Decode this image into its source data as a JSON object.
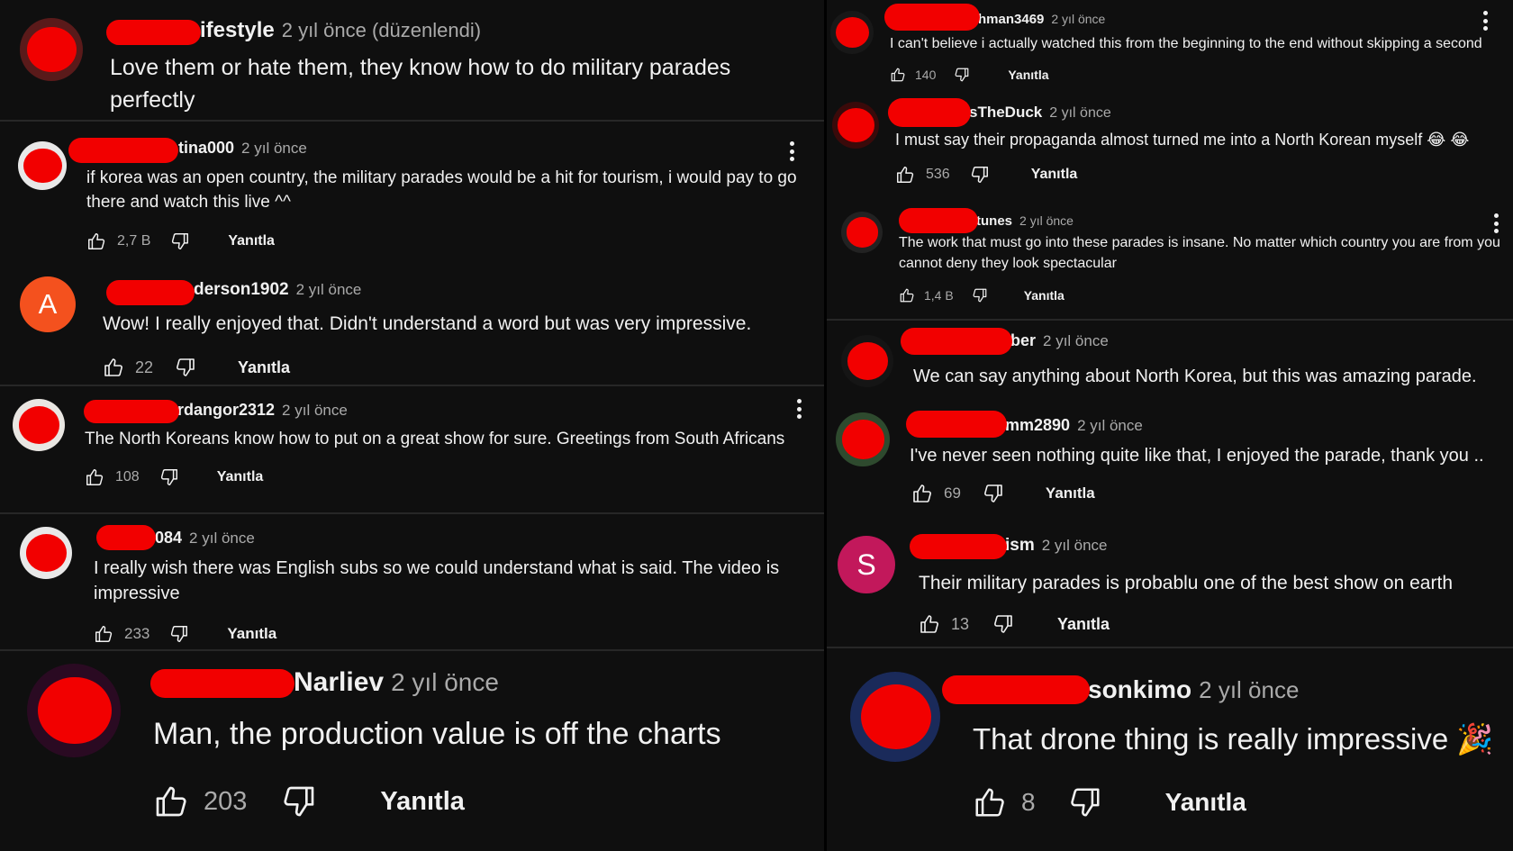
{
  "left_column": {
    "comments": [
      {
        "name": "ifestyle",
        "time": "2 yıl önce (düzenlendi)",
        "text": "Love them or hate them, they know how to do military parades perfectly"
      },
      {
        "name": "tina000",
        "time": "2 yıl önce",
        "text": "if korea was an open country, the military parades would be a hit for tourism, i would pay to go there and watch this live ^^",
        "likes": "2,7 B",
        "reply": "Yanıtla"
      },
      {
        "name": "derson1902",
        "time": "2 yıl önce",
        "avatar_initial": "A",
        "avatar_color": "#f4511e",
        "text": "Wow!  I really enjoyed that.  Didn't understand a word but was very impressive.",
        "likes": "22",
        "reply": "Yanıtla"
      },
      {
        "name": "rdangor2312",
        "time": "2 yıl önce",
        "text": "The North Koreans know how to put on a great show for sure. Greetings from South Africans",
        "likes": "108",
        "reply": "Yanıtla"
      },
      {
        "name": "084",
        "time": "2 yıl önce",
        "text": "I really wish there was English subs so we could understand what is said. The video is impressive",
        "likes": "233",
        "reply": "Yanıtla"
      },
      {
        "name": "Narliev",
        "time": "2 yıl önce",
        "text": "Man, the production value is off the charts",
        "likes": "203",
        "reply": "Yanıtla"
      }
    ]
  },
  "right_column": {
    "comments": [
      {
        "name": "hman3469",
        "time": "2 yıl önce",
        "text": "I can't believe i actually watched this from the beginning to the end without skipping a second",
        "likes": "140",
        "reply": "Yanıtla"
      },
      {
        "name": "sTheDuck",
        "time": "2 yıl önce",
        "text": "I must say their propaganda almost turned me into a North Korean myself 😂 😂",
        "likes": "536",
        "reply": "Yanıtla"
      },
      {
        "name": "tunes",
        "time": "2 yıl önce",
        "text": "The work that must go into these parades is insane. No matter which country you are from you cannot deny they look spectacular",
        "likes": "1,4 B",
        "reply": "Yanıtla"
      },
      {
        "name": "ber",
        "time": "2 yıl önce",
        "text": "We can say anything about North Korea, but this was amazing parade."
      },
      {
        "name": "mm2890",
        "time": "2 yıl önce",
        "text": "I've never seen nothing quite like that, I enjoyed the parade, thank you ..",
        "likes": "69",
        "reply": "Yanıtla"
      },
      {
        "name": "ism",
        "time": "2 yıl önce",
        "avatar_initial": "S",
        "avatar_color": "#c2185b",
        "text": "Their military parades is probablu one of the best show on earth",
        "likes": "13",
        "reply": "Yanıtla"
      },
      {
        "name": "sonkimo",
        "time": "2 yıl önce",
        "text": "That drone thing is really impressive 🎉",
        "likes": "8",
        "reply": "Yanıtla"
      }
    ]
  },
  "colors": {
    "background": "#0f0f0f",
    "redaction": "#f20000",
    "text": "#f1f1f1",
    "muted": "#aaaaaa",
    "separator": "#272727"
  },
  "icons": {
    "like": "thumbs-up-icon",
    "dislike": "thumbs-down-icon",
    "more": "more-vert-icon"
  }
}
